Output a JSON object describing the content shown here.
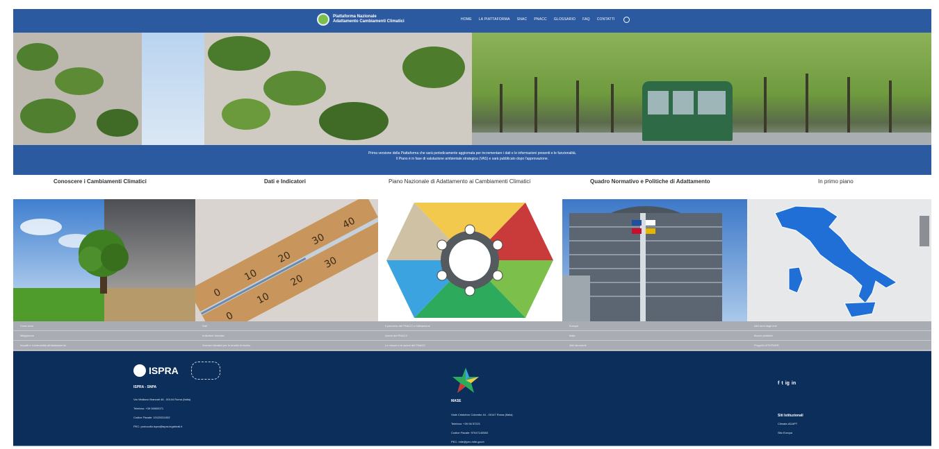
{
  "header": {
    "logo_line1": "Piattaforma Nazionale",
    "logo_line2": "Adattamento Cambiamenti Climatici",
    "nav": [
      "HOME",
      "LA PIATTAFORMA",
      "SNAC",
      "PNACC",
      "GLOSSARIO",
      "FAQ",
      "CONTATTI"
    ],
    "search_icon": "search-icon"
  },
  "banner": {
    "line1": "Prima versione della Piattaforma che sarà periodicamente aggiornata per incrementare i dati e le informazioni presenti e le funzionalità.",
    "line2": "Il Piano è in fase di valutazione ambientale strategica (VAS) e sarà pubblicato dopo l'approvazione."
  },
  "sections": [
    {
      "title": "Conoscere i Cambiamenti Climatici",
      "links": [
        "Cosa sono",
        "Mitigazione",
        "Impatti e vulnerabilità all'adattamento"
      ]
    },
    {
      "title": "Dati e Indicatori",
      "links": [
        "Dati",
        "Indicatori climatici",
        "Scenari climatici per le analisi di rischio"
      ]
    },
    {
      "title": "Piano Nazionale di Adattamento ai Cambiamenti Climatici",
      "links": [
        "Il percorso del PNACC e l'attuazione",
        "Azioni del PNACC",
        "Le misure e le azioni del PNACC"
      ]
    },
    {
      "title": "Quadro Normativo e Politiche di Adattamento",
      "links": [
        "Europa",
        "Italia",
        "Altri strumenti"
      ]
    },
    {
      "title": "In primo piano",
      "links": [
        "Altri temi dagli enti",
        "Buone pratiche",
        "Progetti LIFE/PNRR"
      ]
    }
  ],
  "footer": {
    "ispra": {
      "name": "ISPRA",
      "label": "ISPRA - SNPA",
      "lines": [
        "Via Vitaliano Brancati 48 - 00144 Roma (Italia)",
        "Telefono: +39 06500071",
        "Codice Fiscale: 10125211002",
        "PEC: protocollo.ispra@ispra.legalmail.it"
      ]
    },
    "mase": {
      "label": "MASE",
      "lines": [
        "Viale Cristoforo Colombo 44 - 00147 Roma (Italia)",
        "Telefono: +39 06 57221",
        "Codice Fiscale: 97047140583",
        "PEC: mite@pec.mite.gov.it"
      ]
    },
    "social_icons": [
      "facebook-icon",
      "twitter-icon",
      "instagram-icon",
      "linkedin-icon"
    ],
    "social_text": [
      "f",
      "t",
      "ig",
      "in"
    ],
    "links_title": "Siti Istituzionali",
    "links": [
      "Climate-ADAPT",
      "Sito Europa"
    ]
  },
  "colors": {
    "header_blue": "#2c5aa0",
    "footer_navy": "#0c2e5a",
    "linkbar_gray": "#a9adb3"
  }
}
